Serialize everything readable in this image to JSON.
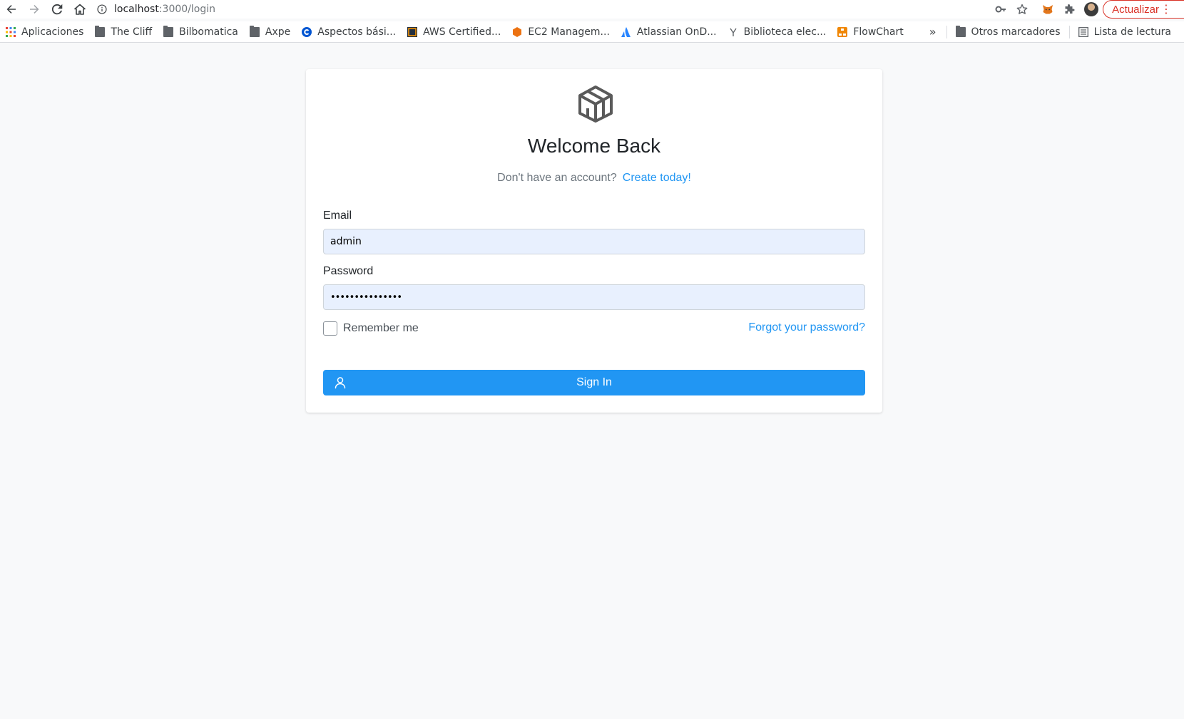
{
  "browser": {
    "url_host": "localhost",
    "url_path": ":3000/login",
    "update_label": "Actualizar",
    "menu_glyph": "⋮"
  },
  "bookmarks": {
    "items": [
      {
        "label": "Aplicaciones",
        "icon": "apps-grid-icon"
      },
      {
        "label": "The Cliff",
        "icon": "folder-icon"
      },
      {
        "label": "Bilbomatica",
        "icon": "folder-icon"
      },
      {
        "label": "Axpe",
        "icon": "folder-icon"
      },
      {
        "label": "Aspectos bási...",
        "icon": "coursera-icon"
      },
      {
        "label": "AWS Certified...",
        "icon": "aws-icon"
      },
      {
        "label": "EC2 Managem...",
        "icon": "ec2-icon"
      },
      {
        "label": "Atlassian OnD...",
        "icon": "atlassian-icon"
      },
      {
        "label": "Biblioteca elec...",
        "icon": "library-icon"
      },
      {
        "label": "FlowChart",
        "icon": "flowchart-icon"
      }
    ],
    "overflow": "»",
    "other": "Otros marcadores",
    "reading_list": "Lista de lectura"
  },
  "login": {
    "title": "Welcome Back",
    "subtitle": "Don't have an account?",
    "create_link": "Create today!",
    "email_label": "Email",
    "email_value": "admin",
    "password_label": "Password",
    "password_value": "•••••••••••••••",
    "remember_label": "Remember me",
    "remember_checked": false,
    "forgot_link": "Forgot your password?",
    "signin_label": "Sign In"
  },
  "colors": {
    "accent": "#2196f3",
    "autofill_bg": "#e8f0fe",
    "page_bg": "#f8f9fa",
    "update_red": "#d93025"
  }
}
